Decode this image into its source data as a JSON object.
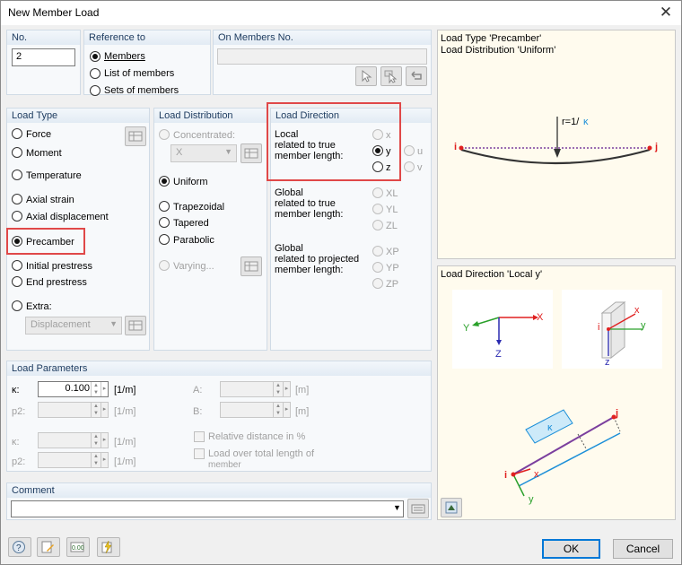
{
  "window": {
    "title": "New Member Load",
    "close_glyph": "✕"
  },
  "no": {
    "header": "No.",
    "value": "2"
  },
  "reference": {
    "header": "Reference to",
    "options": [
      {
        "label": "Members",
        "selected": true
      },
      {
        "label": "List of members",
        "selected": false
      },
      {
        "label": "Sets of members",
        "selected": false
      }
    ]
  },
  "on_members": {
    "header": "On Members No.",
    "value": ""
  },
  "load_type": {
    "header": "Load Type",
    "options": [
      {
        "label": "Force",
        "selected": false
      },
      {
        "label": "Moment",
        "selected": false
      },
      {
        "label": "Temperature",
        "selected": false
      },
      {
        "label": "Axial strain",
        "selected": false
      },
      {
        "label": "Axial displacement",
        "selected": false
      },
      {
        "label": "Precamber",
        "selected": true
      },
      {
        "label": "Initial prestress",
        "selected": false
      },
      {
        "label": "End prestress",
        "selected": false
      },
      {
        "label": "Extra:",
        "selected": false
      }
    ],
    "extra_select": "Displacement"
  },
  "load_distribution": {
    "header": "Load Distribution",
    "concentrated": "Concentrated:",
    "concentrated_select": "X",
    "uniform": "Uniform",
    "trapezoidal": "Trapezoidal",
    "tapered": "Tapered",
    "parabolic": "Parabolic",
    "varying": "Varying..."
  },
  "load_direction": {
    "header": "Load Direction",
    "local_label": "Local",
    "local_sub1": "related to true",
    "local_sub2": "member length:",
    "local_axes": [
      "x",
      "y",
      "z"
    ],
    "local_extra": [
      "u",
      "v"
    ],
    "global_true_1": "Global",
    "global_true_2": "related to true",
    "global_true_3": "member length:",
    "global_true_axes": [
      "XL",
      "YL",
      "ZL"
    ],
    "global_proj_1": "Global",
    "global_proj_2": "related to projected",
    "global_proj_3": "member length:",
    "global_proj_axes": [
      "XP",
      "YP",
      "ZP"
    ]
  },
  "load_parameters": {
    "header": "Load Parameters",
    "kappa1_label": "κ:",
    "kappa1_value": "0.100",
    "kappa1_unit": "[1/m]",
    "p2_1_label": "p2:",
    "p2_1_unit": "[1/m]",
    "a_label": "A:",
    "a_unit": "[m]",
    "b_label": "B:",
    "b_unit": "[m]",
    "kappa2_label": "κ:",
    "kappa2_unit": "[1/m]",
    "p2_2_label": "p2:",
    "p2_2_unit": "[1/m]",
    "relative": "Relative distance in %",
    "overlength_1": "Load over total length of",
    "overlength_2": "member"
  },
  "comment": {
    "header": "Comment",
    "value": ""
  },
  "preview_top": {
    "line1": "Load Type 'Precamber'",
    "line2": "Load Distribution 'Uniform'",
    "radius": "r=1/",
    "kappa": "κ",
    "node_i": "i",
    "node_j": "j"
  },
  "preview_bottom": {
    "caption": "Load Direction 'Local y'",
    "axis_x": "X",
    "axis_y": "Y",
    "axis_z": "Z",
    "local_x": "x",
    "local_y": "y",
    "local_z": "z",
    "local_i": "i",
    "member_kappa": "κ",
    "member_i": "i",
    "member_j": "j",
    "member_x": "x",
    "member_y": "y"
  },
  "footer": {
    "ok": "OK",
    "cancel": "Cancel"
  },
  "colors": {
    "accent_red": "#e04848",
    "blue_kappa": "#1c8fd8",
    "panel_bg": "#fffbee"
  }
}
